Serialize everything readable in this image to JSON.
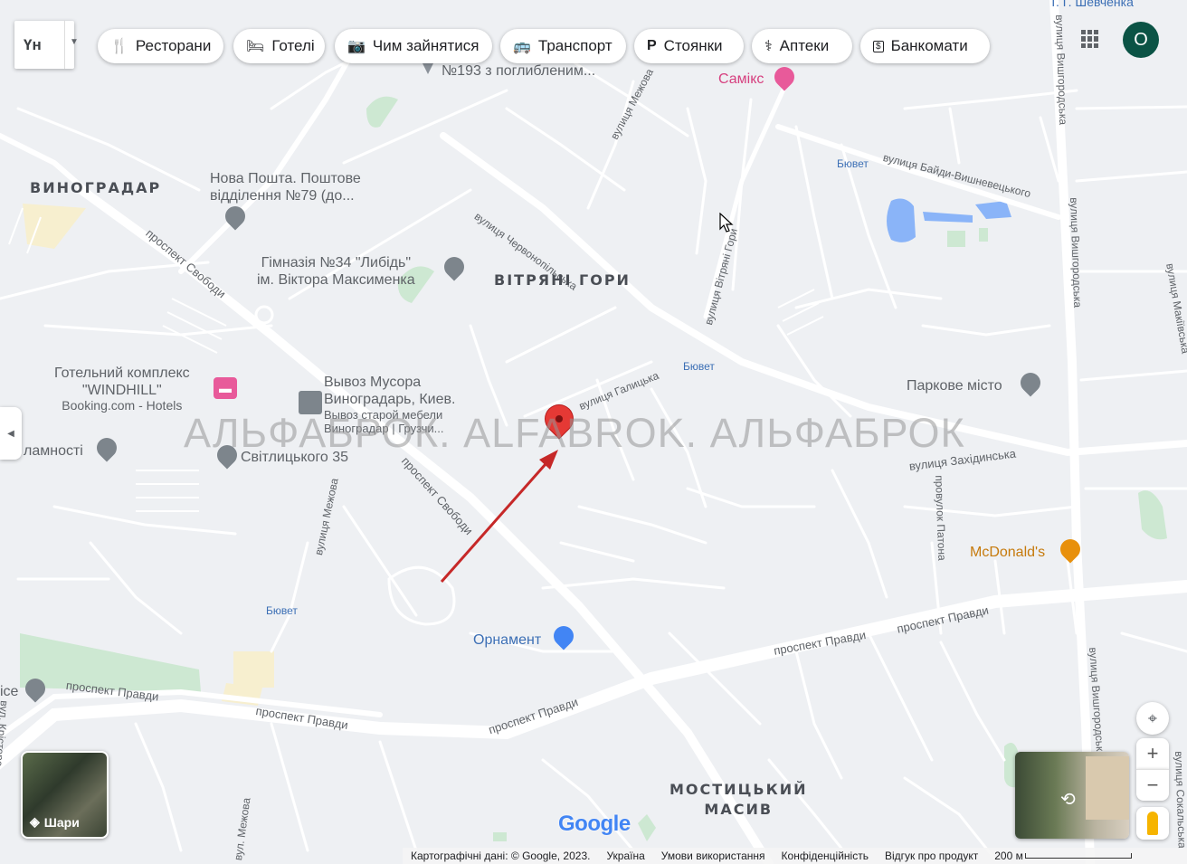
{
  "language_selector": {
    "label": "Үн"
  },
  "chips": [
    {
      "label": "Ресторани",
      "icon": "fork-knife-icon"
    },
    {
      "label": "Готелі",
      "icon": "bed-icon"
    },
    {
      "label": "Чим зайнятися",
      "icon": "camera-icon"
    },
    {
      "label": "Транспорт",
      "icon": "bus-icon"
    },
    {
      "label": "Стоянки",
      "icon": "parking-icon"
    },
    {
      "label": "Аптеки",
      "icon": "pharmacy-icon"
    },
    {
      "label": "Банкомати",
      "icon": "atm-icon"
    }
  ],
  "account": {
    "initial": "O"
  },
  "districts": {
    "vynohradar": "ВИНОГРАДАР",
    "vitriani_hory": "ВІТРЯНІ ГОРИ",
    "mostytskyi_line1": "МОСТИЦЬКИЙ",
    "mostytskyi_line2": "МАСИВ"
  },
  "streets": {
    "chervonopilska": "вулиця Червонопільська",
    "mezhova_top": "вулиця Межова",
    "vitriani_hory": "вулиця Вітряні Гори",
    "baidy": "вулиця Байди-Вишневецького",
    "vyshhorodska_top": "вулиця Вишгородська",
    "vyshhorodska_mid": "вулиця Вишгородська",
    "vyshhorodska_bottom": "вулиця Вишгородська",
    "makiivska": "вулиця Макіївська",
    "svobody_top": "проспект Свободи",
    "svobody_mid": "проспект Свободи",
    "halytska": "вулиця Галицька",
    "zakhidynska": "вулиця Західинська",
    "patona": "провулок Патона",
    "mezhova_mid": "вулиця Межова",
    "mezhova_bottom": "вул. Межова",
    "pravdy_1": "проспект Правди",
    "pravdy_2": "проспект Правди",
    "pravdy_3": "проспект Правди",
    "pravdy_4": "проспект Правди",
    "pravdy_5": "проспект Правди",
    "kristera": "вул. Крістера",
    "sokalska": "вулиця Сокальська",
    "shevchenka": "Т. Г. Шевченка"
  },
  "pois": {
    "school193": "№193 з поглибленим...",
    "samiks": "Самікс",
    "nova_poshta_line1": "Нова Пошта. Поштове",
    "nova_poshta_line2": "відділення №79 (до...",
    "gymnasium_line1": "Гімназія №34 \"Либідь\"",
    "gymnasium_line2": "ім. Віктора Максименка",
    "windhill_line1": "Готельний комплекс",
    "windhill_line2": "\"WINDHILL\"",
    "windhill_line3": "Booking.com - Hotels",
    "vyvoz_line1": "Вывоз Мусора",
    "vyvoz_line2": "Виноградарь, Киев.",
    "vyvoz_line3": "Вывоз старой мебели",
    "vyvoz_line4": "Виноградар | Грузчи...",
    "lamnosti": "ламності",
    "svitlytskoho": "Світлицького 35",
    "parkove": "Паркове місто",
    "mcdonalds": "McDonald's",
    "ornament": "Орнамент",
    "ice": "ice"
  },
  "bus_stops": [
    "Бювет",
    "Бювет",
    "Бювет"
  ],
  "watermark": "АЛЬФАБРОК. ALFABROK. АЛЬФАБРОК",
  "layers_button": {
    "label": "Шари"
  },
  "google_logo": "Google",
  "attribution": {
    "map_data": "Картографічні дані: © Google, 2023.",
    "country": "Україна",
    "terms": "Умови використання",
    "privacy": "Конфіденційність",
    "feedback": "Відгук про продукт",
    "scale": "200 м"
  },
  "colors": {
    "pin": "#e53935",
    "arrow": "#c62828",
    "park": "#c8e6c9",
    "water": "#8ab4f8",
    "account_bg": "#0b5345",
    "hotel_pink": "#e85a9a",
    "mcdonalds": "#e8900c",
    "bus_blue": "#3c6fb5"
  }
}
